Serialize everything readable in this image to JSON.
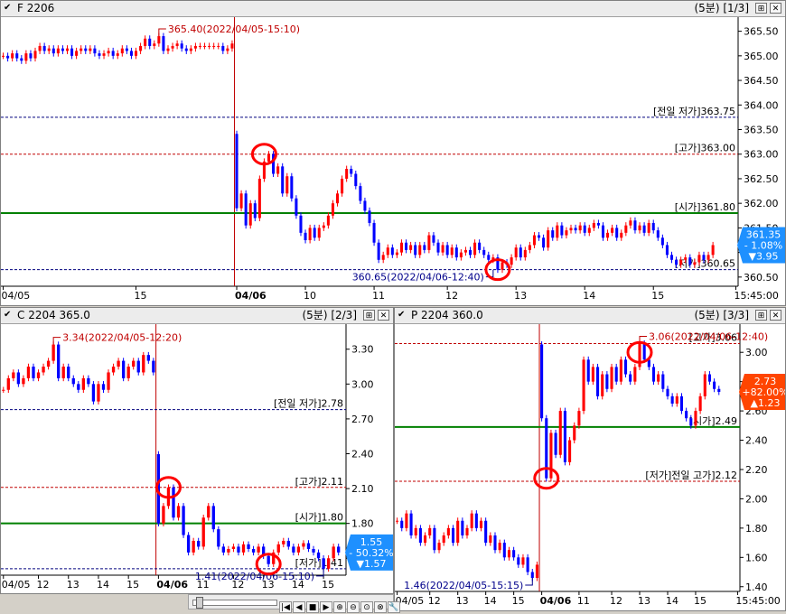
{
  "panels": {
    "top": {
      "title": "F 2206",
      "period": "(5분) [1/3]",
      "price_badge": {
        "price": "361.35",
        "pct": "- 1.08%",
        "change": "▼3.95"
      },
      "x_labels": [
        {
          "t": "04/05",
          "i": 0
        },
        {
          "t": "15",
          "i": 29
        },
        {
          "t": "04/06",
          "i": 51
        },
        {
          "t": "10",
          "i": 66
        },
        {
          "t": "11",
          "i": 81
        },
        {
          "t": "12",
          "i": 97
        },
        {
          "t": "13",
          "i": 112
        },
        {
          "t": "14",
          "i": 127
        },
        {
          "t": "15",
          "i": 142
        },
        {
          "t": "15:45:00",
          "i": 160
        }
      ]
    },
    "left": {
      "title": "C 2204 365.0",
      "period": "(5분) [2/3]",
      "price_badge": {
        "price": "1.55",
        "pct": "- 50.32%",
        "change": "▼1.57"
      },
      "x_labels": [
        {
          "t": "04/05",
          "i": 0
        },
        {
          "t": "12",
          "i": 7
        },
        {
          "t": "13",
          "i": 13
        },
        {
          "t": "14",
          "i": 19
        },
        {
          "t": "15",
          "i": 25
        },
        {
          "t": "04/06",
          "i": 31
        },
        {
          "t": "11",
          "i": 39
        },
        {
          "t": "12",
          "i": 46
        },
        {
          "t": "13",
          "i": 52
        },
        {
          "t": "14",
          "i": 58
        },
        {
          "t": "15",
          "i": 64
        }
      ]
    },
    "right": {
      "title": "P 2204 360.0",
      "period": "(5분) [3/3]",
      "price_badge": {
        "price": "2.73",
        "pct": "+82.00%",
        "change": "▲1.23"
      },
      "x_labels": [
        {
          "t": "04/05",
          "i": 0
        },
        {
          "t": "12",
          "i": 7
        },
        {
          "t": "13",
          "i": 13
        },
        {
          "t": "14",
          "i": 19
        },
        {
          "t": "15",
          "i": 25
        },
        {
          "t": "04/06",
          "i": 31
        },
        {
          "t": "11",
          "i": 39
        },
        {
          "t": "12",
          "i": 46
        },
        {
          "t": "13",
          "i": 52
        },
        {
          "t": "14",
          "i": 58
        },
        {
          "t": "15",
          "i": 64
        },
        {
          "t": "15:45:00",
          "i": 73
        }
      ]
    }
  },
  "colors": {
    "up": "#ff0000",
    "down": "#0000ff",
    "open_line": "#008000",
    "day_line": "#c00000",
    "badge_down": "#1e90ff",
    "badge_up": "#ff4500",
    "prev_low": "#00007f",
    "high_line": "#c00000",
    "annotation_blue": "#00008b",
    "annotation_red": "#c00000"
  },
  "chart_data": [
    {
      "type": "candlestick",
      "title": "F 2206",
      "ylim": [
        360.35,
        365.75
      ],
      "yticks": [
        "365.50",
        "365.00",
        "364.50",
        "364.00",
        "363.50",
        "363.00",
        "362.50",
        "362.00",
        "361.50",
        "361.00",
        "360.50"
      ],
      "ytick_values": [
        365.5,
        365.0,
        364.5,
        364.0,
        363.5,
        363.0,
        362.5,
        362.0,
        361.5,
        361.0,
        360.5
      ],
      "day_break_index": 51,
      "levels": [
        {
          "label": "[전일 저가]363.75",
          "value": 363.75,
          "style": "prev_low"
        },
        {
          "label": "[고가]363.00",
          "value": 363.0,
          "style": "high"
        },
        {
          "label": "[시가]361.80",
          "value": 361.8,
          "style": "open"
        },
        {
          "label": "[저가]360.65",
          "value": 360.65,
          "style": "prev_low"
        }
      ],
      "annotations": [
        {
          "text": "365.40(2022/04/05-15:10)",
          "value": 365.4,
          "index": 34,
          "color": "red"
        },
        {
          "text": "360.65(2022/04/06-12:40)",
          "value": 360.65,
          "index": 107,
          "color": "blue"
        }
      ],
      "circles": [
        {
          "index": 57,
          "value": 363.0
        },
        {
          "index": 108,
          "value": 360.65
        }
      ],
      "closes": [
        365.0,
        364.95,
        365.05,
        364.95,
        364.9,
        365.05,
        364.95,
        365.1,
        365.2,
        365.1,
        365.15,
        365.05,
        365.15,
        365.1,
        365.15,
        365.0,
        365.1,
        365.15,
        365.1,
        365.15,
        365.05,
        365.0,
        365.05,
        365.1,
        365.0,
        365.05,
        365.15,
        365.1,
        365.0,
        365.1,
        365.2,
        365.35,
        365.2,
        365.25,
        365.4,
        365.1,
        365.15,
        365.2,
        365.25,
        365.15,
        365.1,
        365.15,
        365.2,
        365.2,
        365.2,
        365.2,
        365.2,
        365.2,
        365.1,
        365.15,
        365.25,
        361.9,
        362.2,
        361.55,
        362.0,
        361.7,
        362.5,
        362.85,
        363.0,
        362.6,
        362.75,
        362.2,
        362.55,
        362.1,
        361.75,
        361.4,
        361.25,
        361.5,
        361.3,
        361.5,
        361.55,
        361.75,
        362.0,
        362.2,
        362.5,
        362.7,
        362.6,
        362.35,
        362.05,
        361.85,
        361.6,
        361.2,
        360.85,
        360.95,
        361.1,
        360.95,
        361.0,
        361.2,
        361.05,
        361.15,
        360.95,
        361.15,
        361.05,
        361.35,
        361.2,
        361.0,
        361.15,
        360.95,
        361.1,
        360.9,
        361.0,
        361.05,
        360.95,
        361.2,
        361.05,
        360.95,
        360.85,
        360.9,
        360.65,
        360.8,
        360.75,
        360.9,
        361.1,
        360.9,
        361.05,
        361.15,
        361.35,
        361.3,
        361.1,
        361.45,
        361.3,
        361.55,
        361.35,
        361.45,
        361.5,
        361.45,
        361.55,
        361.4,
        361.5,
        361.6,
        361.55,
        361.3,
        361.4,
        361.5,
        361.3,
        361.4,
        361.55,
        361.65,
        361.45,
        361.55,
        361.4,
        361.6,
        361.45,
        361.3,
        361.15,
        360.95,
        360.85,
        360.75,
        360.85,
        360.9,
        360.75,
        360.8,
        360.95,
        360.85,
        360.95,
        361.15
      ]
    },
    {
      "type": "candlestick",
      "title": "C 2204 365.0",
      "ylim": [
        1.37,
        3.5
      ],
      "yticks": [
        "3.30",
        "3.00",
        "2.70",
        "2.40",
        "2.10",
        "1.80",
        "1.50"
      ],
      "ytick_values": [
        3.3,
        3.0,
        2.7,
        2.4,
        2.1,
        1.8,
        1.5
      ],
      "day_break_index": 31,
      "levels": [
        {
          "label": "[전일 저가]2.78",
          "value": 2.78,
          "style": "prev_low"
        },
        {
          "label": "[고가]2.11",
          "value": 2.11,
          "style": "high"
        },
        {
          "label": "[시가]1.80",
          "value": 1.8,
          "style": "open"
        },
        {
          "label": "[저가]1.41",
          "value": 1.41,
          "style": "prev_low"
        }
      ],
      "annotations": [
        {
          "text": "3.34(2022/04/05-12:20)",
          "value": 3.34,
          "index": 10,
          "color": "red"
        },
        {
          "text": "1.41(2022/04/06-15:10)",
          "value": 1.41,
          "index": 64,
          "color": "blue"
        }
      ],
      "circles": [
        {
          "index": 33,
          "value": 2.11
        },
        {
          "index": 53,
          "value": 1.45
        }
      ],
      "closes": [
        2.95,
        3.05,
        3.1,
        3.0,
        3.05,
        3.15,
        3.05,
        3.1,
        3.15,
        3.2,
        3.34,
        3.05,
        3.15,
        3.05,
        3.0,
        2.95,
        3.05,
        3.0,
        2.85,
        3.0,
        2.95,
        3.1,
        3.15,
        3.2,
        3.05,
        3.15,
        3.2,
        3.1,
        3.25,
        3.2,
        3.1,
        1.8,
        1.95,
        2.11,
        1.85,
        1.95,
        1.7,
        1.55,
        1.65,
        1.6,
        1.85,
        1.95,
        1.75,
        1.6,
        1.55,
        1.58,
        1.6,
        1.55,
        1.62,
        1.58,
        1.55,
        1.6,
        1.52,
        1.45,
        1.55,
        1.62,
        1.65,
        1.6,
        1.55,
        1.6,
        1.63,
        1.58,
        1.55,
        1.5,
        1.41,
        1.5,
        1.6,
        1.55
      ]
    },
    {
      "type": "candlestick",
      "title": "P 2204 360.0",
      "ylim": [
        1.38,
        3.18
      ],
      "yticks": [
        "3.00",
        "2.80",
        "2.60",
        "2.40",
        "2.20",
        "2.00",
        "1.80",
        "1.60",
        "1.40"
      ],
      "ytick_values": [
        3.0,
        2.8,
        2.6,
        2.4,
        2.2,
        2.0,
        1.8,
        1.6,
        1.4
      ],
      "day_break_index": 31,
      "levels": [
        {
          "label": "[고가]3.06",
          "value": 3.06,
          "style": "high"
        },
        {
          "label": "[시가]2.49",
          "value": 2.49,
          "style": "open"
        },
        {
          "label": "[저가]전일 고가]2.12",
          "value": 2.12,
          "style": "high_dashed"
        }
      ],
      "annotations": [
        {
          "text": "3.06(2022/04/06-12:40)",
          "value": 3.06,
          "index": 52,
          "color": "red"
        },
        {
          "text": "1.46(2022/04/05-15:15)",
          "value": 1.46,
          "index": 29,
          "color": "blue"
        }
      ],
      "circles": [
        {
          "index": 32,
          "value": 2.14
        },
        {
          "index": 52,
          "value": 3.0
        }
      ],
      "closes": [
        1.85,
        1.8,
        1.9,
        1.75,
        1.8,
        1.7,
        1.75,
        1.8,
        1.65,
        1.7,
        1.75,
        1.8,
        1.7,
        1.85,
        1.75,
        1.8,
        1.9,
        1.8,
        1.85,
        1.7,
        1.75,
        1.65,
        1.7,
        1.6,
        1.65,
        1.6,
        1.55,
        1.6,
        1.5,
        1.46,
        1.55,
        2.55,
        2.14,
        2.45,
        2.3,
        2.6,
        2.25,
        2.4,
        2.5,
        2.6,
        2.95,
        2.8,
        2.9,
        2.7,
        2.85,
        2.75,
        2.9,
        2.8,
        2.95,
        2.85,
        2.8,
        2.9,
        3.06,
        2.95,
        2.9,
        2.8,
        2.85,
        2.75,
        2.7,
        2.65,
        2.7,
        2.6,
        2.55,
        2.5,
        2.6,
        2.7,
        2.85,
        2.8,
        2.75,
        2.73
      ]
    }
  ],
  "toolbar": {
    "buttons": [
      "|◀",
      "◀",
      "■",
      "▶",
      "⊕",
      "⊖",
      "⊙",
      "⊗",
      "🔧"
    ]
  }
}
